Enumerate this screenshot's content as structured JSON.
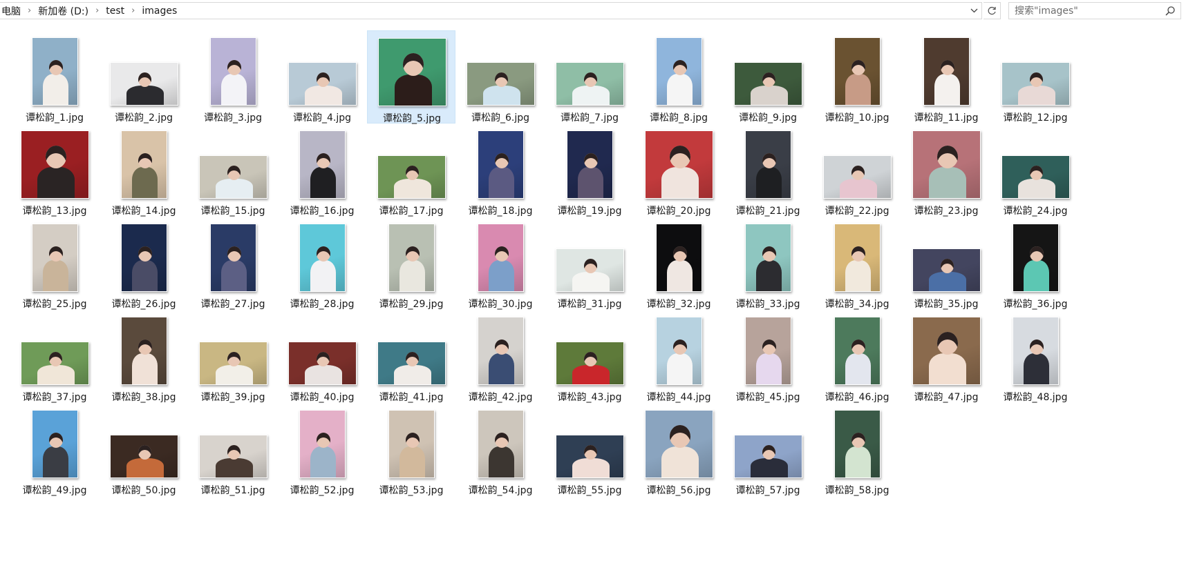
{
  "breadcrumb": [
    "电脑",
    "新加卷 (D:)",
    "test",
    "images"
  ],
  "search": {
    "placeholder": "搜索\"images\""
  },
  "icons": {
    "breadcrumb_sep": "chevron-right-icon",
    "dropdown": "chevron-down-icon",
    "refresh": "refresh-icon",
    "search": "search-icon"
  },
  "selected_index": 4,
  "files": [
    {
      "name": "谭松韵_1.jpg",
      "bg": "#8fb0c8",
      "fg": "#f2eee9",
      "orient": "portrait"
    },
    {
      "name": "谭松韵_2.jpg",
      "bg": "#e9e9ea",
      "fg": "#2b2b2f",
      "orient": "landscape"
    },
    {
      "name": "谭松韵_3.jpg",
      "bg": "#b9b3d6",
      "fg": "#f3f3f7",
      "orient": "portrait"
    },
    {
      "name": "谭松韵_4.jpg",
      "bg": "#b8cad6",
      "fg": "#f1e8e3",
      "orient": "landscape"
    },
    {
      "name": "谭松韵_5.jpg",
      "bg": "#3f9a6e",
      "fg": "#2c1d1a",
      "orient": "square"
    },
    {
      "name": "谭松韵_6.jpg",
      "bg": "#8a9a80",
      "fg": "#cfe3ee",
      "orient": "landscape"
    },
    {
      "name": "谭松韵_7.jpg",
      "bg": "#8fbea6",
      "fg": "#eef3f3",
      "orient": "landscape"
    },
    {
      "name": "谭松韵_8.jpg",
      "bg": "#8fb5dc",
      "fg": "#f5f5f5",
      "orient": "portrait"
    },
    {
      "name": "谭松韵_9.jpg",
      "bg": "#3d5a3c",
      "fg": "#d9d2cc",
      "orient": "landscape"
    },
    {
      "name": "谭松韵_10.jpg",
      "bg": "#6a5231",
      "fg": "#c79b86",
      "orient": "portrait"
    },
    {
      "name": "谭松韵_11.jpg",
      "bg": "#4f3b2f",
      "fg": "#f4f1ee",
      "orient": "portrait"
    },
    {
      "name": "谭松韵_12.jpg",
      "bg": "#a7c3c9",
      "fg": "#e8d9d6",
      "orient": "landscape"
    },
    {
      "name": "谭松韵_13.jpg",
      "bg": "#9a1f22",
      "fg": "#2a2424",
      "orient": "square"
    },
    {
      "name": "谭松韵_14.jpg",
      "bg": "#d9c3a8",
      "fg": "#6d6a4f",
      "orient": "portrait"
    },
    {
      "name": "谭松韵_15.jpg",
      "bg": "#c9c5b8",
      "fg": "#e6eef2",
      "orient": "landscape"
    },
    {
      "name": "谭松韵_16.jpg",
      "bg": "#b8b6c6",
      "fg": "#1f1f22",
      "orient": "portrait"
    },
    {
      "name": "谭松韵_17.jpg",
      "bg": "#6e9455",
      "fg": "#efe6dc",
      "orient": "landscape"
    },
    {
      "name": "谭松韵_18.jpg",
      "bg": "#2c3f7a",
      "fg": "#5b5a82",
      "orient": "portrait"
    },
    {
      "name": "谭松韵_19.jpg",
      "bg": "#20294f",
      "fg": "#5d536e",
      "orient": "portrait"
    },
    {
      "name": "谭松韵_20.jpg",
      "bg": "#c23a3c",
      "fg": "#f0e4de",
      "orient": "square"
    },
    {
      "name": "谭松韵_21.jpg",
      "bg": "#3a3e47",
      "fg": "#1e1f22",
      "orient": "portrait"
    },
    {
      "name": "谭松韵_22.jpg",
      "bg": "#cfd3d6",
      "fg": "#e7c5cf",
      "orient": "landscape"
    },
    {
      "name": "谭松韵_23.jpg",
      "bg": "#b77278",
      "fg": "#a7bfb7",
      "orient": "square"
    },
    {
      "name": "谭松韵_24.jpg",
      "bg": "#2f5f5a",
      "fg": "#e8e2dd",
      "orient": "landscape"
    },
    {
      "name": "谭松韵_25.jpg",
      "bg": "#d4cdc4",
      "fg": "#c9b49a",
      "orient": "portrait"
    },
    {
      "name": "谭松韵_26.jpg",
      "bg": "#1b2a4d",
      "fg": "#4a4c66",
      "orient": "portrait"
    },
    {
      "name": "谭松韵_27.jpg",
      "bg": "#2a3b66",
      "fg": "#5c5f84",
      "orient": "portrait"
    },
    {
      "name": "谭松韵_28.jpg",
      "bg": "#5ec8d9",
      "fg": "#f2f2f4",
      "orient": "portrait"
    },
    {
      "name": "谭松韵_29.jpg",
      "bg": "#b9c0b3",
      "fg": "#e9e7df",
      "orient": "portrait"
    },
    {
      "name": "谭松韵_30.jpg",
      "bg": "#d98ab0",
      "fg": "#7c9fc9",
      "orient": "portrait"
    },
    {
      "name": "谭松韵_31.jpg",
      "bg": "#dfe6e3",
      "fg": "#f5f5f2",
      "orient": "landscape"
    },
    {
      "name": "谭松韵_32.jpg",
      "bg": "#0d0d0f",
      "fg": "#efe7e2",
      "orient": "portrait"
    },
    {
      "name": "谭松韵_33.jpg",
      "bg": "#8ec6c0",
      "fg": "#2c2c30",
      "orient": "portrait"
    },
    {
      "name": "谭松韵_34.jpg",
      "bg": "#d9b878",
      "fg": "#f1e9dd",
      "orient": "portrait"
    },
    {
      "name": "谭松韵_35.jpg",
      "bg": "#43455f",
      "fg": "#4b6fa6",
      "orient": "landscape"
    },
    {
      "name": "谭松韵_36.jpg",
      "bg": "#151515",
      "fg": "#5cc7b3",
      "orient": "portrait"
    },
    {
      "name": "谭松韵_37.jpg",
      "bg": "#6f9b58",
      "fg": "#f0e6d8",
      "orient": "landscape"
    },
    {
      "name": "谭松韵_38.jpg",
      "bg": "#5a4a3c",
      "fg": "#f0e1d7",
      "orient": "portrait"
    },
    {
      "name": "谭松韵_39.jpg",
      "bg": "#c9b783",
      "fg": "#f2efe8",
      "orient": "landscape"
    },
    {
      "name": "谭松韵_40.jpg",
      "bg": "#7a2f2a",
      "fg": "#e9e3e1",
      "orient": "landscape"
    },
    {
      "name": "谭松韵_41.jpg",
      "bg": "#3f7a87",
      "fg": "#f0ece8",
      "orient": "landscape"
    },
    {
      "name": "谭松韵_42.jpg",
      "bg": "#d5d2ce",
      "fg": "#3a4d73",
      "orient": "portrait"
    },
    {
      "name": "谭松韵_43.jpg",
      "bg": "#5e7a3a",
      "fg": "#c9262b",
      "orient": "landscape"
    },
    {
      "name": "谭松韵_44.jpg",
      "bg": "#b7d2e0",
      "fg": "#f5f5f5",
      "orient": "portrait"
    },
    {
      "name": "谭松韵_45.jpg",
      "bg": "#b7a39b",
      "fg": "#e6d8ee",
      "orient": "portrait"
    },
    {
      "name": "谭松韵_46.jpg",
      "bg": "#4d7a5c",
      "fg": "#e3e6ee",
      "orient": "portrait"
    },
    {
      "name": "谭松韵_47.jpg",
      "bg": "#8a6a4d",
      "fg": "#f2ded0",
      "orient": "square"
    },
    {
      "name": "谭松韵_48.jpg",
      "bg": "#d7dbe0",
      "fg": "#2d2f38",
      "orient": "portrait"
    },
    {
      "name": "谭松韵_49.jpg",
      "bg": "#5aa2d8",
      "fg": "#3a3d44",
      "orient": "portrait"
    },
    {
      "name": "谭松韵_50.jpg",
      "bg": "#3b2a22",
      "fg": "#c46a3a",
      "orient": "landscape"
    },
    {
      "name": "谭松韵_51.jpg",
      "bg": "#d8d3cd",
      "fg": "#4a3b33",
      "orient": "landscape"
    },
    {
      "name": "谭松韵_52.jpg",
      "bg": "#e4b0c8",
      "fg": "#9cb4c9",
      "orient": "portrait"
    },
    {
      "name": "谭松韵_53.jpg",
      "bg": "#cfc2b3",
      "fg": "#d2b99c",
      "orient": "portrait"
    },
    {
      "name": "谭松韵_54.jpg",
      "bg": "#cdc6bc",
      "fg": "#3c3631",
      "orient": "portrait"
    },
    {
      "name": "谭松韵_55.jpg",
      "bg": "#2f3f54",
      "fg": "#f0ddd6",
      "orient": "landscape"
    },
    {
      "name": "谭松韵_56.jpg",
      "bg": "#8aa4bf",
      "fg": "#f0e3d8",
      "orient": "square"
    },
    {
      "name": "谭松韵_57.jpg",
      "bg": "#8ea4c9",
      "fg": "#2a2d3a",
      "orient": "landscape"
    },
    {
      "name": "谭松韵_58.jpg",
      "bg": "#3a5a47",
      "fg": "#d3e4d0",
      "orient": "portrait"
    }
  ]
}
